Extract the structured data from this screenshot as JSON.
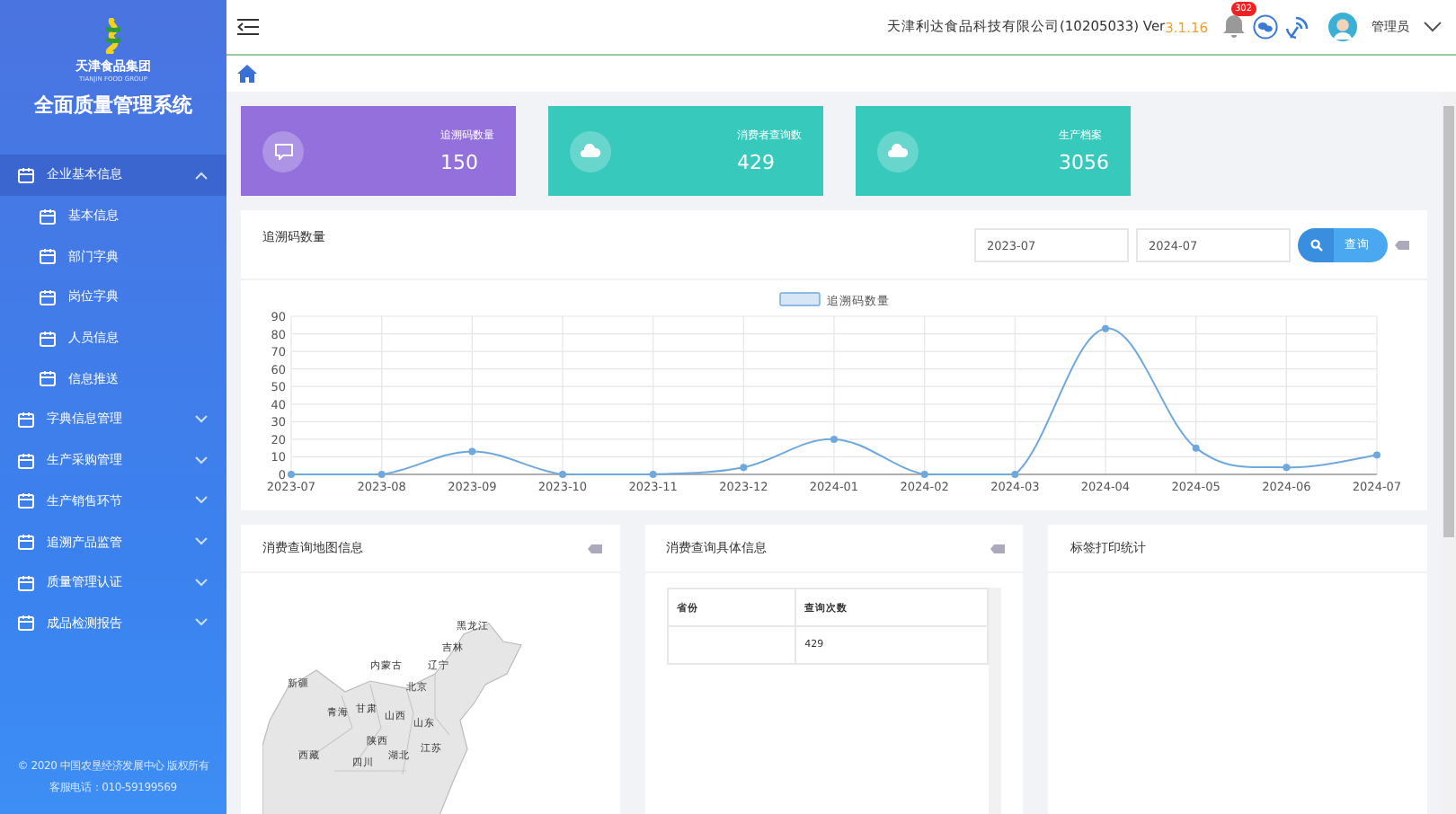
{
  "sidebar": {
    "logo_text": "天津食品集团",
    "logo_subtext": "TIANJIN FOOD GROUP",
    "system_title": "全面质量管理系统",
    "items": [
      {
        "label": "企业基本信息",
        "kind": "group",
        "expanded": true,
        "selected": true,
        "children": [
          {
            "label": "基本信息",
            "kind": "sub",
            "selected": false
          },
          {
            "label": "部门字典",
            "kind": "sub",
            "selected": false
          },
          {
            "label": "岗位字典",
            "kind": "sub",
            "selected": false
          },
          {
            "label": "人员信息",
            "kind": "sub",
            "selected": false
          },
          {
            "label": "信息推送",
            "kind": "sub",
            "selected": false
          }
        ]
      },
      {
        "label": "字典信息管理",
        "kind": "group",
        "expanded": false,
        "selected": false
      },
      {
        "label": "生产采购管理",
        "kind": "group",
        "expanded": false,
        "selected": false
      },
      {
        "label": "生产销售环节",
        "kind": "group",
        "expanded": false,
        "selected": false
      },
      {
        "label": "追溯产品监管",
        "kind": "group",
        "expanded": false,
        "selected": false
      },
      {
        "label": "质量管理认证",
        "kind": "group",
        "expanded": false,
        "selected": false
      },
      {
        "label": "成品检测报告",
        "kind": "group",
        "expanded": false,
        "selected": false
      }
    ],
    "footer": [
      "© 2020 中国农垦经济发展中心 版权所有",
      "客服电话：010-59199569"
    ]
  },
  "header": {
    "company": "天津利达食品科技有限公司(10205033) Ver",
    "version": "3.1.16",
    "notification_count": "302",
    "user": "管理员"
  },
  "stats": [
    {
      "label": "追溯码数量",
      "value": "150",
      "color": "#9370db",
      "kind": "chat"
    },
    {
      "label": "消费者查询数",
      "value": "429",
      "color": "#36c9bc",
      "kind": "cloud"
    },
    {
      "label": "生产档案",
      "value": "3056",
      "color": "#36c9bc",
      "kind": "cloud"
    }
  ],
  "trace_panel": {
    "title": "追溯码数量",
    "start": "2023-07",
    "end": "2024-07",
    "query_button": "查询",
    "chart_data": {
      "type": "line",
      "categories": [
        "2023-07",
        "2023-08",
        "2023-09",
        "2023-10",
        "2023-11",
        "2023-12",
        "2024-01",
        "2024-02",
        "2024-03",
        "2024-04",
        "2024-05",
        "2024-06",
        "2024-07"
      ],
      "series": [
        {
          "name": "追溯码数量",
          "color": "#6fa8dc",
          "marker": true,
          "values": [
            0,
            0,
            13,
            0,
            0,
            4,
            20,
            0,
            0,
            83,
            15,
            4,
            11
          ]
        }
      ],
      "grid": true,
      "ylim": [
        0,
        90
      ],
      "yticks": [
        0,
        10,
        20,
        30,
        40,
        50,
        60,
        70,
        80,
        90
      ]
    }
  },
  "map_panel": {
    "title": "消费查询地图信息",
    "regions": [
      "黑龙江",
      "吉林",
      "内蒙古",
      "辽宁",
      "新疆",
      "北京",
      "青海",
      "甘肃",
      "山西",
      "山东",
      "陕西",
      "西藏",
      "四川",
      "湖北",
      "江苏"
    ]
  },
  "detail_panel": {
    "title": "消费查询具体信息",
    "columns": [
      "省份",
      "查询次数"
    ],
    "rows": [
      {
        "count": "429"
      }
    ]
  },
  "label_panel": {
    "title": "标签打印统计"
  }
}
